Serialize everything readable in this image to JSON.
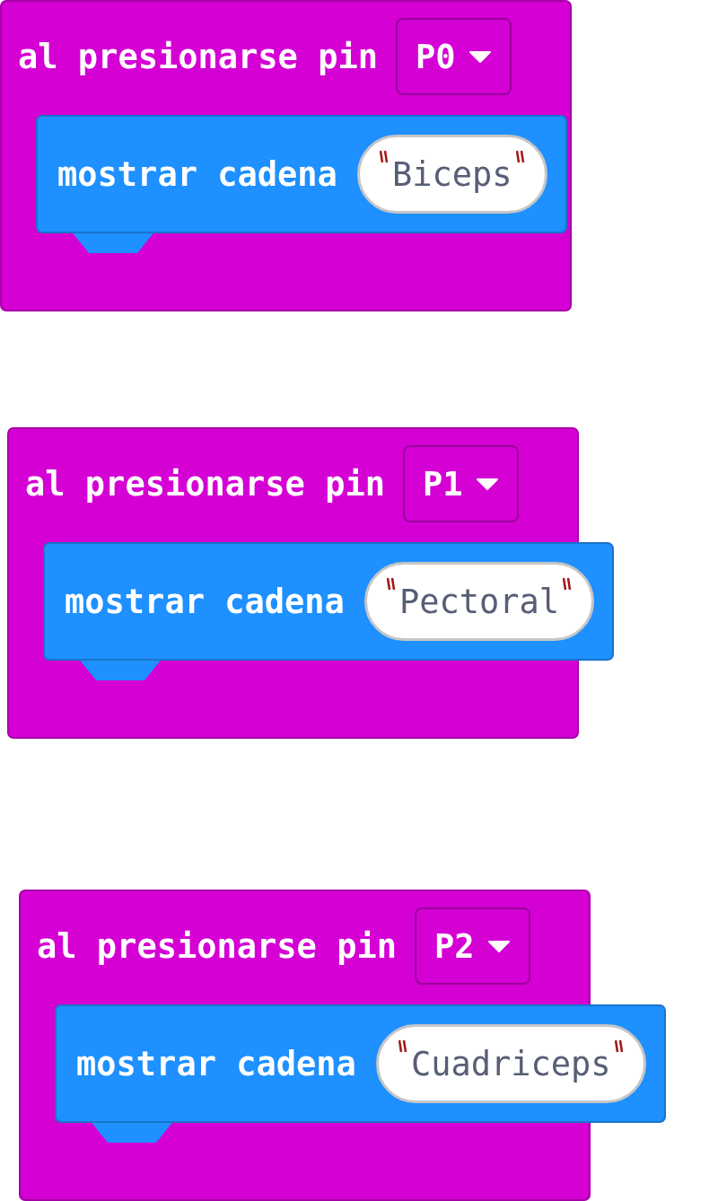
{
  "blocks": [
    {
      "label": "al presionarse pin",
      "pin": "P0",
      "statement": {
        "label": "mostrar cadena",
        "value": "Biceps"
      }
    },
    {
      "label": "al presionarse pin",
      "pin": "P1",
      "statement": {
        "label": "mostrar cadena",
        "value": "Pectoral"
      }
    },
    {
      "label": "al presionarse pin",
      "pin": "P2",
      "statement": {
        "label": "mostrar cadena",
        "value": "Cuadriceps"
      }
    }
  ]
}
